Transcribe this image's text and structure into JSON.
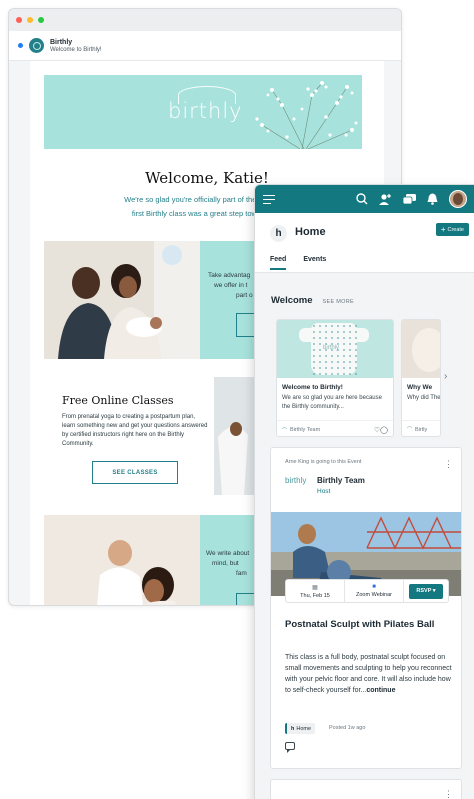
{
  "email": {
    "sender": "Birthly",
    "subject": "Welcome to Birthly!",
    "logo_text": "birthly",
    "welcome_title": "Welcome, Katie!",
    "welcome_line1": "We're so glad you're officially part of the Birthly fam",
    "welcome_line2": "first Birthly class was a great step towards a m",
    "panel1_line1": "Take advantag",
    "panel1_line2": "we offer in t",
    "panel1_line3": "part o",
    "classes_title": "Free Online Classes",
    "classes_desc": "From prenatal yoga to creating a postpartum plan, learn something new and get your questions answered by certified instructors right here on the Birthly Community.",
    "see_classes": "SEE CLASSES",
    "panel2_line1": "We write about",
    "panel2_line2": "mind, but",
    "panel2_line3": "fam"
  },
  "community": {
    "page_title": "Home",
    "home_badge": "h",
    "create_label": "Create",
    "tabs": [
      {
        "label": "Feed"
      },
      {
        "label": "Events"
      }
    ],
    "welcome_label": "Welcome",
    "see_more": "SEE MORE",
    "cards": [
      {
        "image_word": "birthly",
        "title": "Welcome to Birthly!",
        "text": "We are so glad you are here because the Birthly community...",
        "author": "Birthly Team"
      },
      {
        "title": "Why We",
        "text": "Why did There arc",
        "author": "Birtly"
      }
    ],
    "post": {
      "meta": "Arne King is going to this Event",
      "host_logo": "birthly",
      "host_name": "Birthly Team",
      "host_role": "Host",
      "date": "Thu, Feb 15",
      "location": "Zoom Webinar",
      "rsvp": "RSVP ▾",
      "title": "Postnatal Sculpt with Pilates Ball",
      "desc": "This class is a full body, postnatal sculpt focused on small movements and sculpting to help you reconnect with your pelvic floor and core. It will also include how to self-check yourself for...",
      "continue": "continue",
      "chip": "Home",
      "posted": "Posted 1w ago"
    }
  },
  "colors": {
    "teal": "#13787f",
    "mint": "#a8e2dc",
    "accent_text": "#23808a"
  }
}
